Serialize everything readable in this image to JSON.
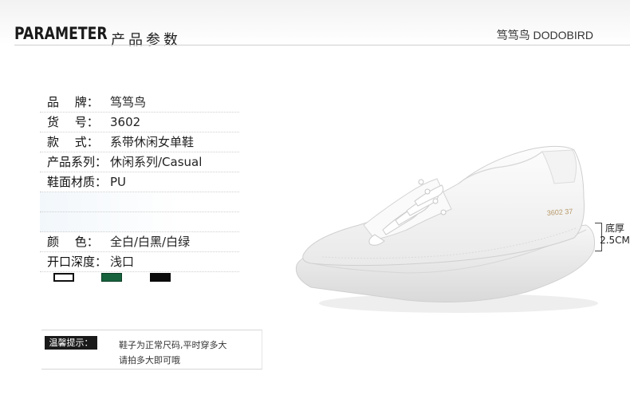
{
  "header": {
    "title_en": "PARAMETER",
    "title_cn": "产品参数",
    "brand": "笃笃鸟  DODOBIRD"
  },
  "params": [
    {
      "label": "品　 牌：",
      "value": "笃笃鸟"
    },
    {
      "label": "货　 号：",
      "value": "3602"
    },
    {
      "label": "款　 式：",
      "value": "系带休闲女单鞋"
    },
    {
      "label": "产品系列：",
      "value": "休闲系列/Casual"
    },
    {
      "label": "鞋面材质：",
      "value": "PU"
    }
  ],
  "params2": [
    {
      "label": "颜　 色：",
      "value": "全白/白黑/白绿"
    },
    {
      "label": "开口深度：",
      "value": "浅口"
    }
  ],
  "swatches": [
    {
      "name": "全白",
      "color": "#ffffff"
    },
    {
      "name": "白绿",
      "color": "#16633d"
    },
    {
      "name": "白黑",
      "color": "#0a0a0a"
    }
  ],
  "tip": {
    "label": "温馨提示：",
    "line1": "鞋子为正常尺码,平时穿多大",
    "line2": "请拍多大即可哦"
  },
  "shoe": {
    "print_code": "3602  37",
    "depth_label_1": "底厚",
    "depth_label_2": "2.5CM"
  }
}
